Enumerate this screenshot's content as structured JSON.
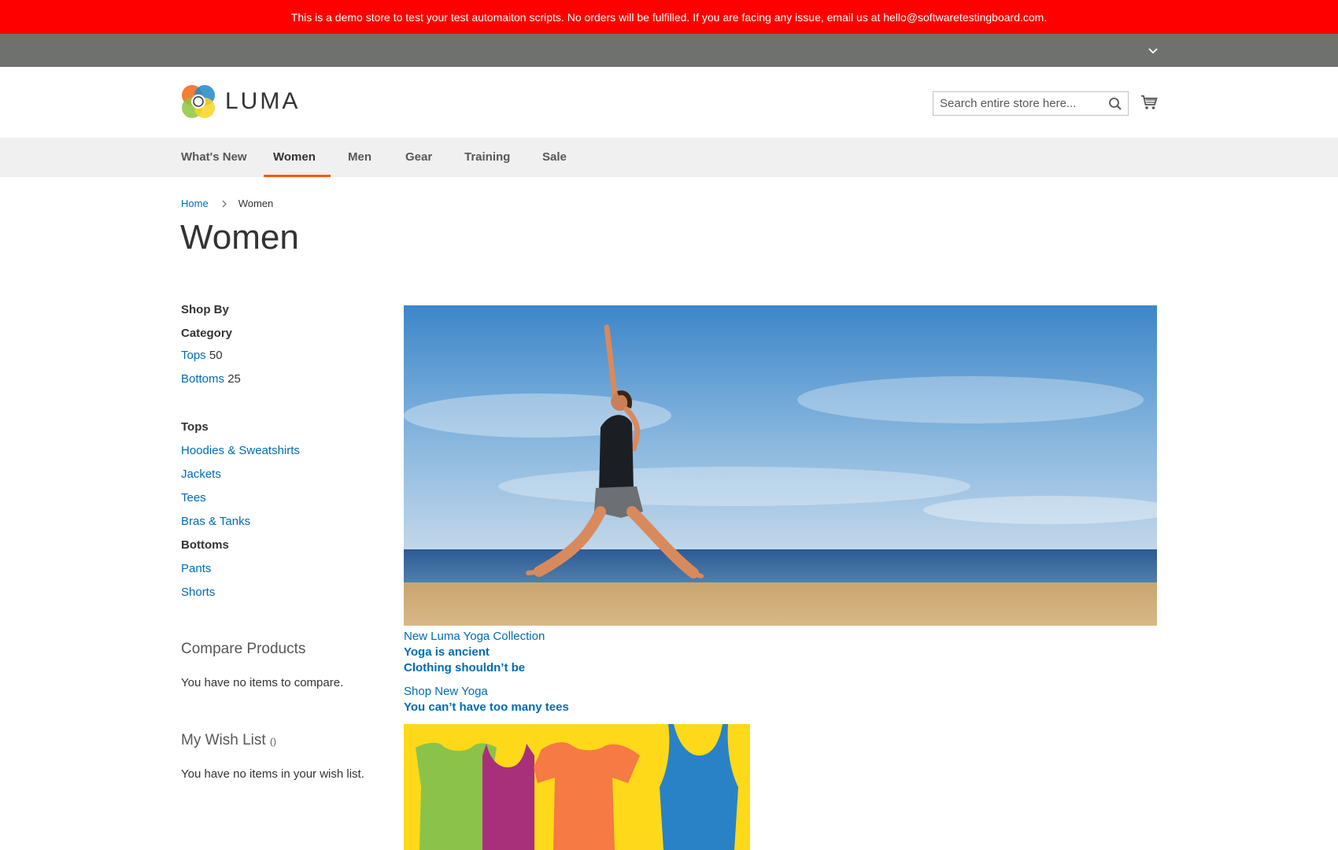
{
  "banner": {
    "text": "This is a demo store to test your test automaiton scripts. No orders will be fulfilled. If you are facing any issue, email us at hello@softwaretestingboard.com."
  },
  "panel": {
    "toggle_icon": "chevron-down-icon"
  },
  "header": {
    "logo_text": "LUMA",
    "search_placeholder": "Search entire store here...",
    "search_icon": "search-icon",
    "cart_icon": "cart-icon"
  },
  "nav": {
    "items": [
      {
        "label": "What's New",
        "active": false
      },
      {
        "label": "Women",
        "active": true
      },
      {
        "label": "Men",
        "active": false
      },
      {
        "label": "Gear",
        "active": false
      },
      {
        "label": "Training",
        "active": false
      },
      {
        "label": "Sale",
        "active": false
      }
    ],
    "accent": "#ff5501"
  },
  "breadcrumb": {
    "home": "Home",
    "current": "Women"
  },
  "page_title": "Women",
  "sidebar": {
    "shop_by": "Shop By",
    "category_label": "Category",
    "categories": [
      {
        "label": "Tops",
        "count": "50"
      },
      {
        "label": "Bottoms",
        "count": "25"
      }
    ],
    "tops_heading": "Tops",
    "tops_links": [
      "Hoodies & Sweatshirts",
      "Jackets",
      "Tees",
      "Bras & Tanks"
    ],
    "bottoms_heading": "Bottoms",
    "bottoms_links": [
      "Pants",
      "Shorts"
    ],
    "compare_title": "Compare Products",
    "compare_empty": "You have no items to compare.",
    "wishlist_title": "My Wish List",
    "wishlist_counter": "()",
    "wishlist_empty": "You have no items in your wish list."
  },
  "promo": {
    "hero_link": "New Luma Yoga Collection",
    "hero_line1": "Yoga is ancient",
    "hero_line2": "Clothing shouldn’t be",
    "shop_link": "Shop New Yoga",
    "tees_line": "You can’t have too many tees"
  },
  "colors": {
    "banner": "#ff0000",
    "panel": "#6e716e",
    "link": "#006bb4",
    "nav_bg": "#f0f0f0"
  }
}
